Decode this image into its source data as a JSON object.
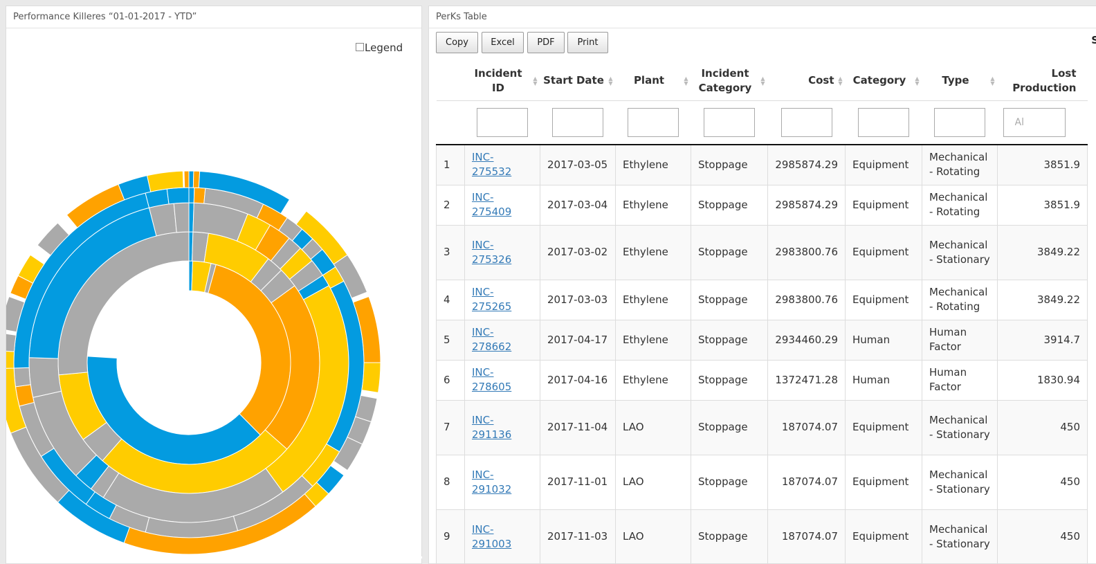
{
  "left_panel": {
    "title": "Performance Killeres “01-01-2017 - YTD”",
    "legend_label": "Legend"
  },
  "colors": {
    "blue": "#039BE0",
    "gray": "#AAAAAA",
    "yellow": "#FFCC00",
    "orange": "#FFA200",
    "link": "#337ab7"
  },
  "chart_data": {
    "type": "sunburst",
    "title": "",
    "legend": "hidden",
    "rings": [
      [
        {
          "start": 0,
          "end": 0.6,
          "color": "blue"
        },
        {
          "start": 0.6,
          "end": 3.5,
          "color": "yellow"
        },
        {
          "start": 3.5,
          "end": 4.3,
          "color": "gray"
        },
        {
          "start": 4.3,
          "end": 37.6,
          "color": "orange"
        },
        {
          "start": 37.6,
          "end": 76,
          "color": "blue"
        }
      ],
      [
        {
          "start": 0,
          "end": 0.5,
          "color": "blue"
        },
        {
          "start": 0.5,
          "end": 2.4,
          "color": "gray"
        },
        {
          "start": 2.4,
          "end": 10.4,
          "color": "yellow"
        },
        {
          "start": 10.4,
          "end": 12.5,
          "color": "gray"
        },
        {
          "start": 12.5,
          "end": 15,
          "color": "gray"
        },
        {
          "start": 15,
          "end": 36.5,
          "color": "orange"
        },
        {
          "start": 36.5,
          "end": 61.5,
          "color": "yellow"
        },
        {
          "start": 61.5,
          "end": 65,
          "color": "gray"
        },
        {
          "start": 65,
          "end": 73.5,
          "color": "yellow"
        },
        {
          "start": 73.5,
          "end": 100,
          "color": "gray"
        }
      ],
      [
        {
          "start": 0,
          "end": 0.5,
          "color": "blue"
        },
        {
          "start": 0.5,
          "end": 6,
          "color": "gray"
        },
        {
          "start": 6,
          "end": 8.5,
          "color": "yellow"
        },
        {
          "start": 8.5,
          "end": 10.8,
          "color": "orange"
        },
        {
          "start": 10.8,
          "end": 12.3,
          "color": "gray"
        },
        {
          "start": 12.3,
          "end": 14,
          "color": "yellow"
        },
        {
          "start": 14,
          "end": 15.8,
          "color": "gray"
        },
        {
          "start": 15.8,
          "end": 17,
          "color": "blue"
        },
        {
          "start": 17,
          "end": 40,
          "color": "yellow"
        },
        {
          "start": 40,
          "end": 59,
          "color": "gray"
        },
        {
          "start": 59,
          "end": 60.5,
          "color": "gray"
        },
        {
          "start": 60.5,
          "end": 62.5,
          "color": "blue"
        },
        {
          "start": 62.5,
          "end": 71.5,
          "color": "gray"
        },
        {
          "start": 71.5,
          "end": 75.5,
          "color": "gray"
        },
        {
          "start": 75.5,
          "end": 96,
          "color": "blue"
        },
        {
          "start": 96,
          "end": 98.5,
          "color": "gray"
        },
        {
          "start": 98.5,
          "end": 100,
          "color": "gray"
        }
      ],
      [
        {
          "start": 0,
          "end": 0.5,
          "color": "blue"
        },
        {
          "start": 0.5,
          "end": 1.5,
          "color": "orange"
        },
        {
          "start": 1.5,
          "end": 7,
          "color": "gray"
        },
        {
          "start": 7,
          "end": 9.5,
          "color": "orange"
        },
        {
          "start": 9.5,
          "end": 11.2,
          "color": "gray"
        },
        {
          "start": 11.2,
          "end": 12.5,
          "color": "blue"
        },
        {
          "start": 12.5,
          "end": 13.8,
          "color": "gray"
        },
        {
          "start": 13.8,
          "end": 15.8,
          "color": "blue"
        },
        {
          "start": 15.8,
          "end": 17.3,
          "color": "yellow"
        },
        {
          "start": 17.3,
          "end": 33.5,
          "color": "blue"
        },
        {
          "start": 33.5,
          "end": 37.5,
          "color": "yellow"
        },
        {
          "start": 37.5,
          "end": 45.5,
          "color": "gray"
        },
        {
          "start": 45.5,
          "end": 54,
          "color": "gray"
        },
        {
          "start": 54,
          "end": 57.5,
          "color": "gray"
        },
        {
          "start": 57.5,
          "end": 60,
          "color": "blue"
        },
        {
          "start": 60,
          "end": 66,
          "color": "blue"
        },
        {
          "start": 66,
          "end": 71,
          "color": "gray"
        },
        {
          "start": 71,
          "end": 72.8,
          "color": "orange"
        },
        {
          "start": 72.8,
          "end": 74.5,
          "color": "gray"
        },
        {
          "start": 74.5,
          "end": 96,
          "color": "blue"
        },
        {
          "start": 96,
          "end": 98,
          "color": "blue"
        },
        {
          "start": 98,
          "end": 100,
          "color": "blue"
        }
      ],
      [
        {
          "start": 0,
          "end": 0.4,
          "color": "blue"
        },
        {
          "start": 0.4,
          "end": 0.9,
          "color": "orange"
        },
        {
          "start": 0.9,
          "end": 8.8,
          "color": "blue"
        },
        {
          "start": 10.5,
          "end": 15.5,
          "color": "yellow"
        },
        {
          "start": 15.5,
          "end": 19,
          "color": "gray"
        },
        {
          "start": 19.4,
          "end": 25,
          "color": "orange"
        },
        {
          "start": 25,
          "end": 27.5,
          "color": "yellow"
        },
        {
          "start": 28,
          "end": 30,
          "color": "gray"
        },
        {
          "start": 30,
          "end": 32,
          "color": "gray"
        },
        {
          "start": 32,
          "end": 34.5,
          "color": "gray"
        },
        {
          "start": 35,
          "end": 37,
          "color": "blue"
        },
        {
          "start": 37,
          "end": 38.5,
          "color": "yellow"
        },
        {
          "start": 38.5,
          "end": 55.5,
          "color": "orange"
        },
        {
          "start": 55.5,
          "end": 62,
          "color": "blue"
        },
        {
          "start": 62,
          "end": 69,
          "color": "gray"
        },
        {
          "start": 69,
          "end": 74.5,
          "color": "yellow"
        },
        {
          "start": 74.5,
          "end": 76,
          "color": "yellow"
        },
        {
          "start": 76,
          "end": 77.5,
          "color": "gray"
        },
        {
          "start": 77.8,
          "end": 80.6,
          "color": "gray"
        },
        {
          "start": 80.9,
          "end": 82.5,
          "color": "orange"
        },
        {
          "start": 82.5,
          "end": 84.5,
          "color": "yellow"
        },
        {
          "start": 85.5,
          "end": 88,
          "color": "gray"
        },
        {
          "start": 89,
          "end": 94,
          "color": "orange"
        },
        {
          "start": 94,
          "end": 96.5,
          "color": "blue"
        },
        {
          "start": 96.5,
          "end": 99.5,
          "color": "yellow"
        },
        {
          "start": 99.6,
          "end": 100,
          "color": "orange"
        }
      ]
    ]
  },
  "right_panel": {
    "title": "PerKs Table",
    "buttons": [
      "Copy",
      "Excel",
      "PDF",
      "Print"
    ],
    "search_label_cut": "S",
    "columns": [
      "",
      "Incident ID",
      "Start Date",
      "Plant",
      "Incident Category",
      "Cost",
      "Category",
      "Type",
      "Lost Production"
    ],
    "filter_placeholder_lost": "Al",
    "rows": [
      {
        "n": "1",
        "id": "INC-275532",
        "date": "2017-03-05",
        "plant": "Ethylene",
        "icat": "Stoppage",
        "cost": "2985874.29",
        "cat": "Equipment",
        "type": "Mechanical - Rotating",
        "lost": "3851.9"
      },
      {
        "n": "2",
        "id": "INC-275409",
        "date": "2017-03-04",
        "plant": "Ethylene",
        "icat": "Stoppage",
        "cost": "2985874.29",
        "cat": "Equipment",
        "type": "Mechanical - Rotating",
        "lost": "3851.9"
      },
      {
        "n": "3",
        "id": "INC-275326",
        "date": "2017-03-02",
        "plant": "Ethylene",
        "icat": "Stoppage",
        "cost": "2983800.76",
        "cat": "Equipment",
        "type": "Mechanical - Stationary",
        "lost": "3849.22"
      },
      {
        "n": "4",
        "id": "INC-275265",
        "date": "2017-03-03",
        "plant": "Ethylene",
        "icat": "Stoppage",
        "cost": "2983800.76",
        "cat": "Equipment",
        "type": "Mechanical - Rotating",
        "lost": "3849.22"
      },
      {
        "n": "5",
        "id": "INC-278662",
        "date": "2017-04-17",
        "plant": "Ethylene",
        "icat": "Stoppage",
        "cost": "2934460.29",
        "cat": "Human",
        "type": "Human Factor",
        "lost": "3914.7"
      },
      {
        "n": "6",
        "id": "INC-278605",
        "date": "2017-04-16",
        "plant": "Ethylene",
        "icat": "Stoppage",
        "cost": "1372471.28",
        "cat": "Human",
        "type": "Human Factor",
        "lost": "1830.94"
      },
      {
        "n": "7",
        "id": "INC-291136",
        "date": "2017-11-04",
        "plant": "LAO",
        "icat": "Stoppage",
        "cost": "187074.07",
        "cat": "Equipment",
        "type": "Mechanical - Stationary",
        "lost": "450"
      },
      {
        "n": "8",
        "id": "INC-291032",
        "date": "2017-11-01",
        "plant": "LAO",
        "icat": "Stoppage",
        "cost": "187074.07",
        "cat": "Equipment",
        "type": "Mechanical - Stationary",
        "lost": "450"
      },
      {
        "n": "9",
        "id": "INC-291003",
        "date": "2017-11-03",
        "plant": "LAO",
        "icat": "Stoppage",
        "cost": "187074.07",
        "cat": "Equipment",
        "type": "Mechanical - Stationary",
        "lost": "450"
      }
    ]
  }
}
